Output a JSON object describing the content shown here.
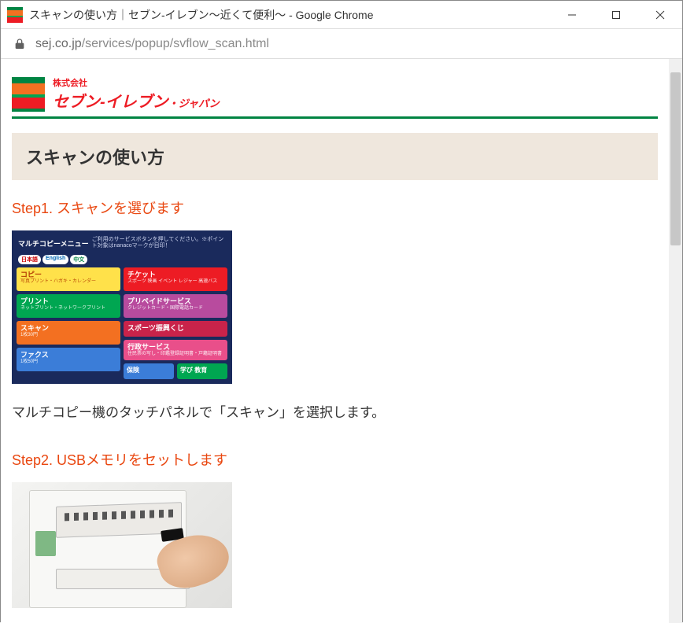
{
  "window": {
    "title": "スキャンの使い方｜セブン‐イレブン～近くて便利～ - Google Chrome"
  },
  "address": {
    "host": "sej.co.jp",
    "path": "/services/popup/svflow_scan.html"
  },
  "logo": {
    "kabushiki": "株式会社",
    "brand": "セブン‐イレブン",
    "suffix": "・ジャパン"
  },
  "page": {
    "heading": "スキャンの使い方",
    "step1_title": "Step1. スキャンを選びます",
    "step1_desc": "マルチコピー機のタッチパネルで「スキャン」を選択します。",
    "step2_title": "Step2. USBメモリをセットします"
  },
  "mc": {
    "header_title": "マルチコピーメニュー",
    "header_note": "ご利用のサービスボタンを押してください。※ポイント対象はnanacoマークが目印！",
    "langs": [
      "日本語",
      "English",
      "中文"
    ],
    "left": [
      {
        "label": "コピー",
        "sub": "写真プリント・ハガキ・カレンダー"
      },
      {
        "label": "プリント",
        "sub": "ネットプリント・ネットワークプリント"
      },
      {
        "label": "スキャン",
        "sub": "1枚30円"
      },
      {
        "label": "ファクス",
        "sub": "1枚50円"
      }
    ],
    "right": [
      {
        "label": "チケット",
        "sub": "スポーツ 映画 イベント レジャー 高速バス"
      },
      {
        "label": "プリペイドサービス",
        "sub": "クレジットカード・国際電話カード"
      },
      {
        "label": "スポーツ振興くじ"
      },
      {
        "label": "行政サービス",
        "sub": "住民票の写し・印鑑登録証明書・戸籍証明書"
      }
    ],
    "bottom": {
      "ins": "保険",
      "edu": "学び 教育"
    }
  }
}
